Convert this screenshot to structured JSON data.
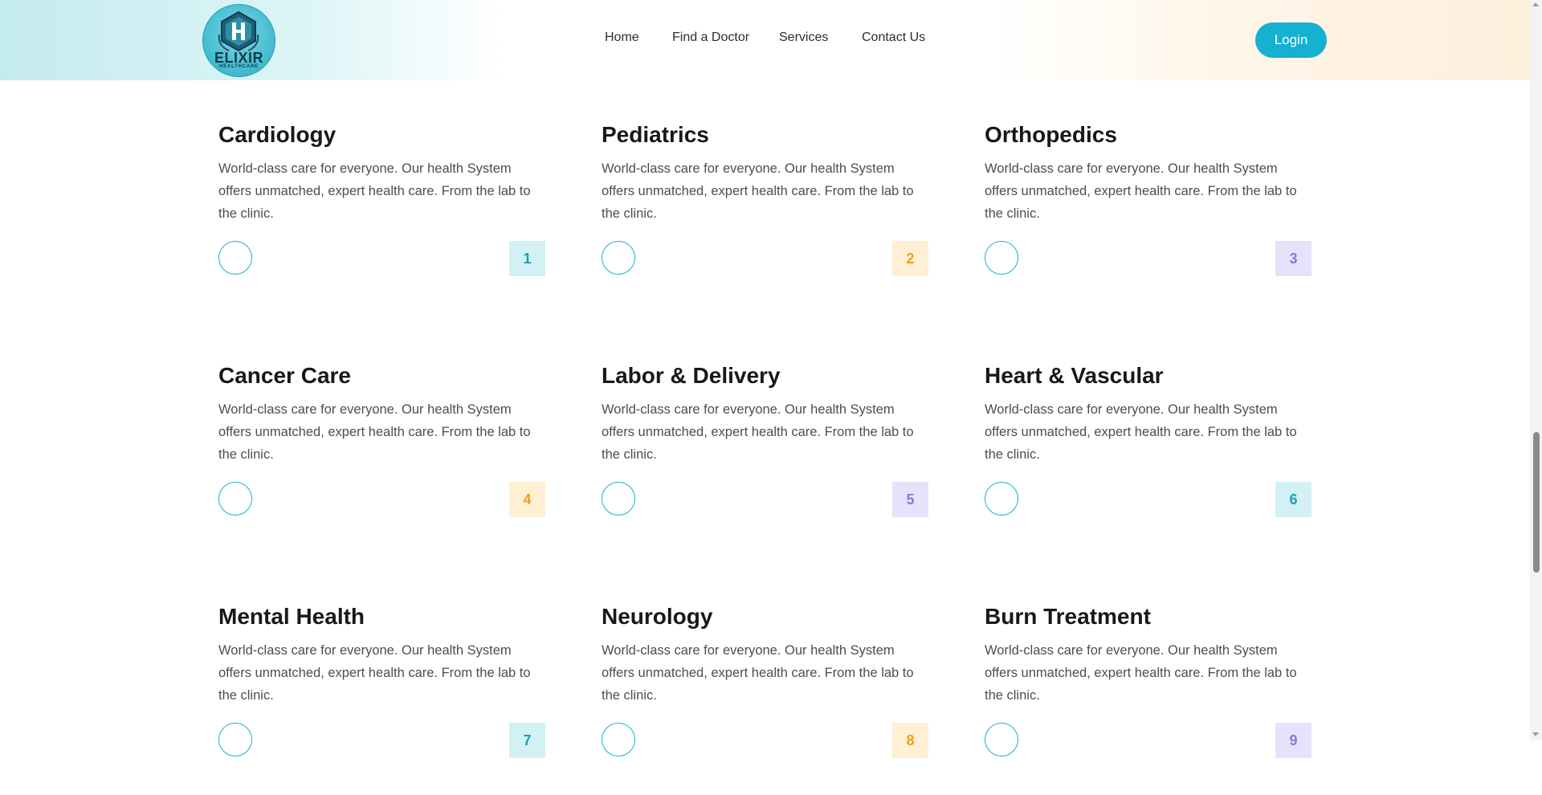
{
  "brand": {
    "name": "ELIXIR",
    "tagline": "HEALTHCARE",
    "icon": "hexagon-h-logo-icon"
  },
  "nav": {
    "items": [
      {
        "label": "Home"
      },
      {
        "label": "Find a Doctor"
      },
      {
        "label": "Services"
      },
      {
        "label": "Contact Us"
      }
    ],
    "login_label": "Login"
  },
  "colors": {
    "accent": "#14b1d1",
    "cyan_bg": "#d3f1f4",
    "cyan_fg": "#1a9fb8",
    "amber_bg": "#fff0d4",
    "amber_fg": "#eba21c",
    "violet_bg": "#e7e2fb",
    "violet_fg": "#8c75d8"
  },
  "services": [
    {
      "title": "Cardiology",
      "desc": "World-class care for everyone. Our health System offers unmatched, expert health care. From the lab to the clinic.",
      "number": "1",
      "tone": "cyan"
    },
    {
      "title": "Pediatrics",
      "desc": "World-class care for everyone. Our health System offers unmatched, expert health care. From the lab to the clinic.",
      "number": "2",
      "tone": "amber"
    },
    {
      "title": "Orthopedics",
      "desc": "World-class care for everyone. Our health System offers unmatched, expert health care. From the lab to the clinic.",
      "number": "3",
      "tone": "violet"
    },
    {
      "title": "Cancer Care",
      "desc": "World-class care for everyone. Our health System offers unmatched, expert health care. From the lab to the clinic.",
      "number": "4",
      "tone": "amber"
    },
    {
      "title": "Labor & Delivery",
      "desc": "World-class care for everyone. Our health System offers unmatched, expert health care. From the lab to the clinic.",
      "number": "5",
      "tone": "violet"
    },
    {
      "title": "Heart & Vascular",
      "desc": "World-class care for everyone. Our health System offers unmatched, expert health care. From the lab to the clinic.",
      "number": "6",
      "tone": "cyan"
    },
    {
      "title": "Mental Health",
      "desc": "World-class care for everyone. Our health System offers unmatched, expert health care. From the lab to the clinic.",
      "number": "7",
      "tone": "cyan"
    },
    {
      "title": "Neurology",
      "desc": "World-class care for everyone. Our health System offers unmatched, expert health care. From the lab to the clinic.",
      "number": "8",
      "tone": "amber"
    },
    {
      "title": "Burn Treatment",
      "desc": "World-class care for everyone. Our health System offers unmatched, expert health care. From the lab to the clinic.",
      "number": "9",
      "tone": "violet"
    }
  ]
}
